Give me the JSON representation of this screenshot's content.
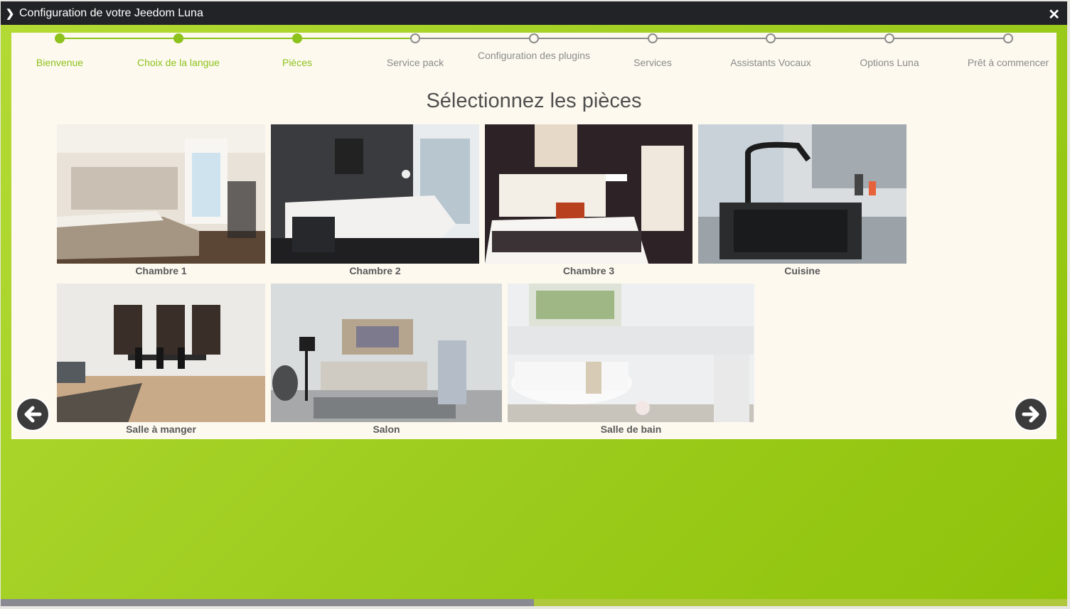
{
  "window": {
    "title": "Configuration de votre Jeedom Luna"
  },
  "steps": [
    {
      "label": "Bienvenue",
      "status": "done"
    },
    {
      "label": "Choix de la langue",
      "status": "done"
    },
    {
      "label": "Pièces",
      "status": "done"
    },
    {
      "label": "Service pack",
      "status": "todo"
    },
    {
      "label": "Configuration des plugins",
      "status": "todo"
    },
    {
      "label": "Services",
      "status": "todo"
    },
    {
      "label": "Assistants Vocaux",
      "status": "todo"
    },
    {
      "label": "Options Luna",
      "status": "todo"
    },
    {
      "label": "Prêt à commencer",
      "status": "todo"
    }
  ],
  "heading": "Sélectionnez les pièces",
  "rooms": [
    {
      "label": "Chambre 1",
      "scene": "bedroom-light"
    },
    {
      "label": "Chambre 2",
      "scene": "bedroom-dark"
    },
    {
      "label": "Chambre 3",
      "scene": "bedroom-hotel"
    },
    {
      "label": "Cuisine",
      "scene": "kitchen-sink"
    },
    {
      "label": "Salle à manger",
      "scene": "dining-room"
    },
    {
      "label": "Salon",
      "scene": "living-room"
    },
    {
      "label": "Salle de bain",
      "scene": "bathroom"
    }
  ],
  "navigation": {
    "prev_icon": "arrow-left-circle-icon",
    "next_icon": "arrow-right-circle-icon"
  },
  "scrollbar": {
    "position_fraction": 0.5
  },
  "colors": {
    "accent": "#8cc21b",
    "inactive": "#8b8b8b",
    "titlebar": "#222326",
    "panel": "#fdf9ef"
  }
}
